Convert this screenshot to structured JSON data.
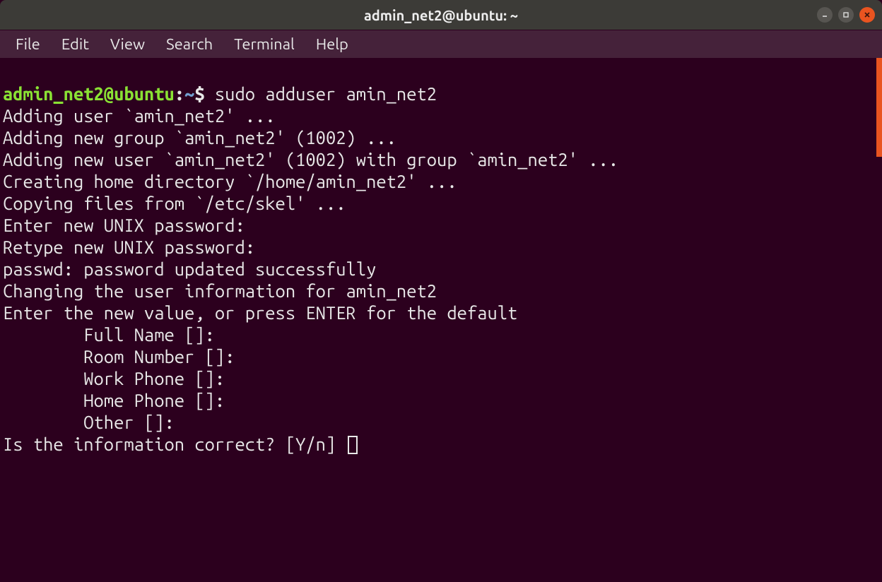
{
  "window": {
    "title": "admin_net2@ubuntu: ~"
  },
  "menubar": {
    "items": [
      "File",
      "Edit",
      "View",
      "Search",
      "Terminal",
      "Help"
    ]
  },
  "prompt": {
    "user_host": "admin_net2@ubuntu",
    "colon": ":",
    "path": "~",
    "dollar": "$ "
  },
  "command": "sudo adduser amin_net2",
  "output": {
    "l0": "Adding user `amin_net2' ...",
    "l1": "Adding new group `amin_net2' (1002) ...",
    "l2": "Adding new user `amin_net2' (1002) with group `amin_net2' ...",
    "l3": "Creating home directory `/home/amin_net2' ...",
    "l4": "Copying files from `/etc/skel' ...",
    "l5": "Enter new UNIX password:",
    "l6": "Retype new UNIX password:",
    "l7": "passwd: password updated successfully",
    "l8": "Changing the user information for amin_net2",
    "l9": "Enter the new value, or press ENTER for the default",
    "l10": "        Full Name []:",
    "l11": "        Room Number []:",
    "l12": "        Work Phone []:",
    "l13": "        Home Phone []:",
    "l14": "        Other []:",
    "l15": "Is the information correct? [Y/n] "
  },
  "colors": {
    "bg": "#2c001e",
    "titlebar": "#3c3b37",
    "accent": "#e95420",
    "prompt_user": "#8ae234",
    "prompt_path": "#729fcf"
  }
}
